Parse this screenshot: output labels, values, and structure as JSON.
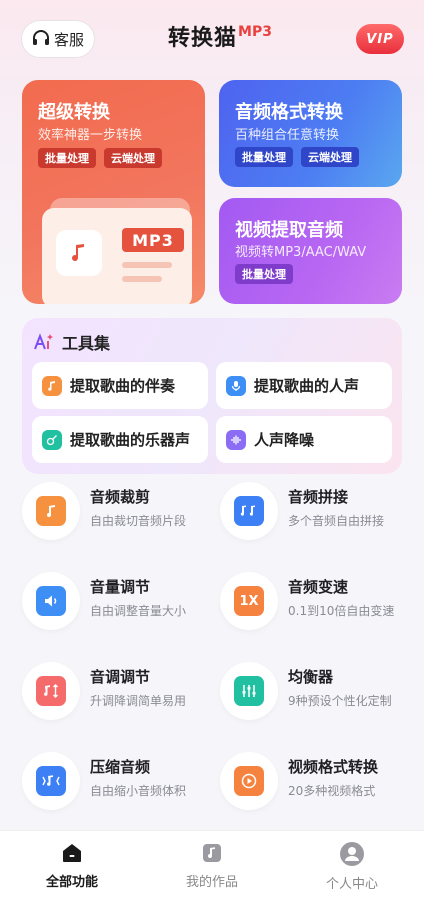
{
  "header": {
    "service_label": "客服",
    "logo_text": "转换猫",
    "logo_sup": "MP3",
    "vip_label": "VIP"
  },
  "cards": {
    "super": {
      "title": "超级转换",
      "subtitle": "效率神器一步转换",
      "tags": [
        "批量处理",
        "云端处理"
      ],
      "badge": "MP3"
    },
    "audio": {
      "title": "音频格式转换",
      "subtitle": "百种组合任意转换",
      "tags": [
        "批量处理",
        "云端处理"
      ]
    },
    "video": {
      "title": "视频提取音频",
      "subtitle": "视频转MP3/AAC/WAV",
      "tags": [
        "批量处理"
      ]
    }
  },
  "tools": {
    "title": "工具集",
    "items": [
      {
        "label": "提取歌曲的伴奏",
        "icon": "music-note-icon",
        "color": "#f5913f"
      },
      {
        "label": "提取歌曲的人声",
        "icon": "microphone-icon",
        "color": "#3d8ff5"
      },
      {
        "label": "提取歌曲的乐器声",
        "icon": "guitar-icon",
        "color": "#20c0a0"
      },
      {
        "label": "人声降噪",
        "icon": "waveform-icon",
        "color": "#8a6cf5"
      }
    ]
  },
  "features": [
    {
      "title": "音频裁剪",
      "subtitle": "自由裁切音频片段",
      "icon": "audio-trim-icon",
      "color": "#f5913f"
    },
    {
      "title": "音频拼接",
      "subtitle": "多个音频自由拼接",
      "icon": "audio-merge-icon",
      "color": "#3d7ff5"
    },
    {
      "title": "音量调节",
      "subtitle": "自由调整音量大小",
      "icon": "volume-icon",
      "color": "#3d8ff5"
    },
    {
      "title": "音频变速",
      "subtitle": "0.1到10倍自由变速",
      "icon": "speed-icon",
      "color": "#f5833f",
      "badge": "1X"
    },
    {
      "title": "音调调节",
      "subtitle": "升调降调简单易用",
      "icon": "pitch-icon",
      "color": "#f56a6a"
    },
    {
      "title": "均衡器",
      "subtitle": "9种预设个性化定制",
      "icon": "equalizer-icon",
      "color": "#20c0a0"
    },
    {
      "title": "压缩音频",
      "subtitle": "自由缩小音频体积",
      "icon": "compress-icon",
      "color": "#3d7ff5"
    },
    {
      "title": "视频格式转换",
      "subtitle": "20多种视频格式",
      "icon": "video-convert-icon",
      "color": "#f5833f"
    }
  ],
  "nav": {
    "items": [
      {
        "label": "全部功能",
        "icon": "home-icon",
        "active": true
      },
      {
        "label": "我的作品",
        "icon": "works-icon",
        "active": false
      },
      {
        "label": "个人中心",
        "icon": "user-icon",
        "active": false
      }
    ]
  }
}
